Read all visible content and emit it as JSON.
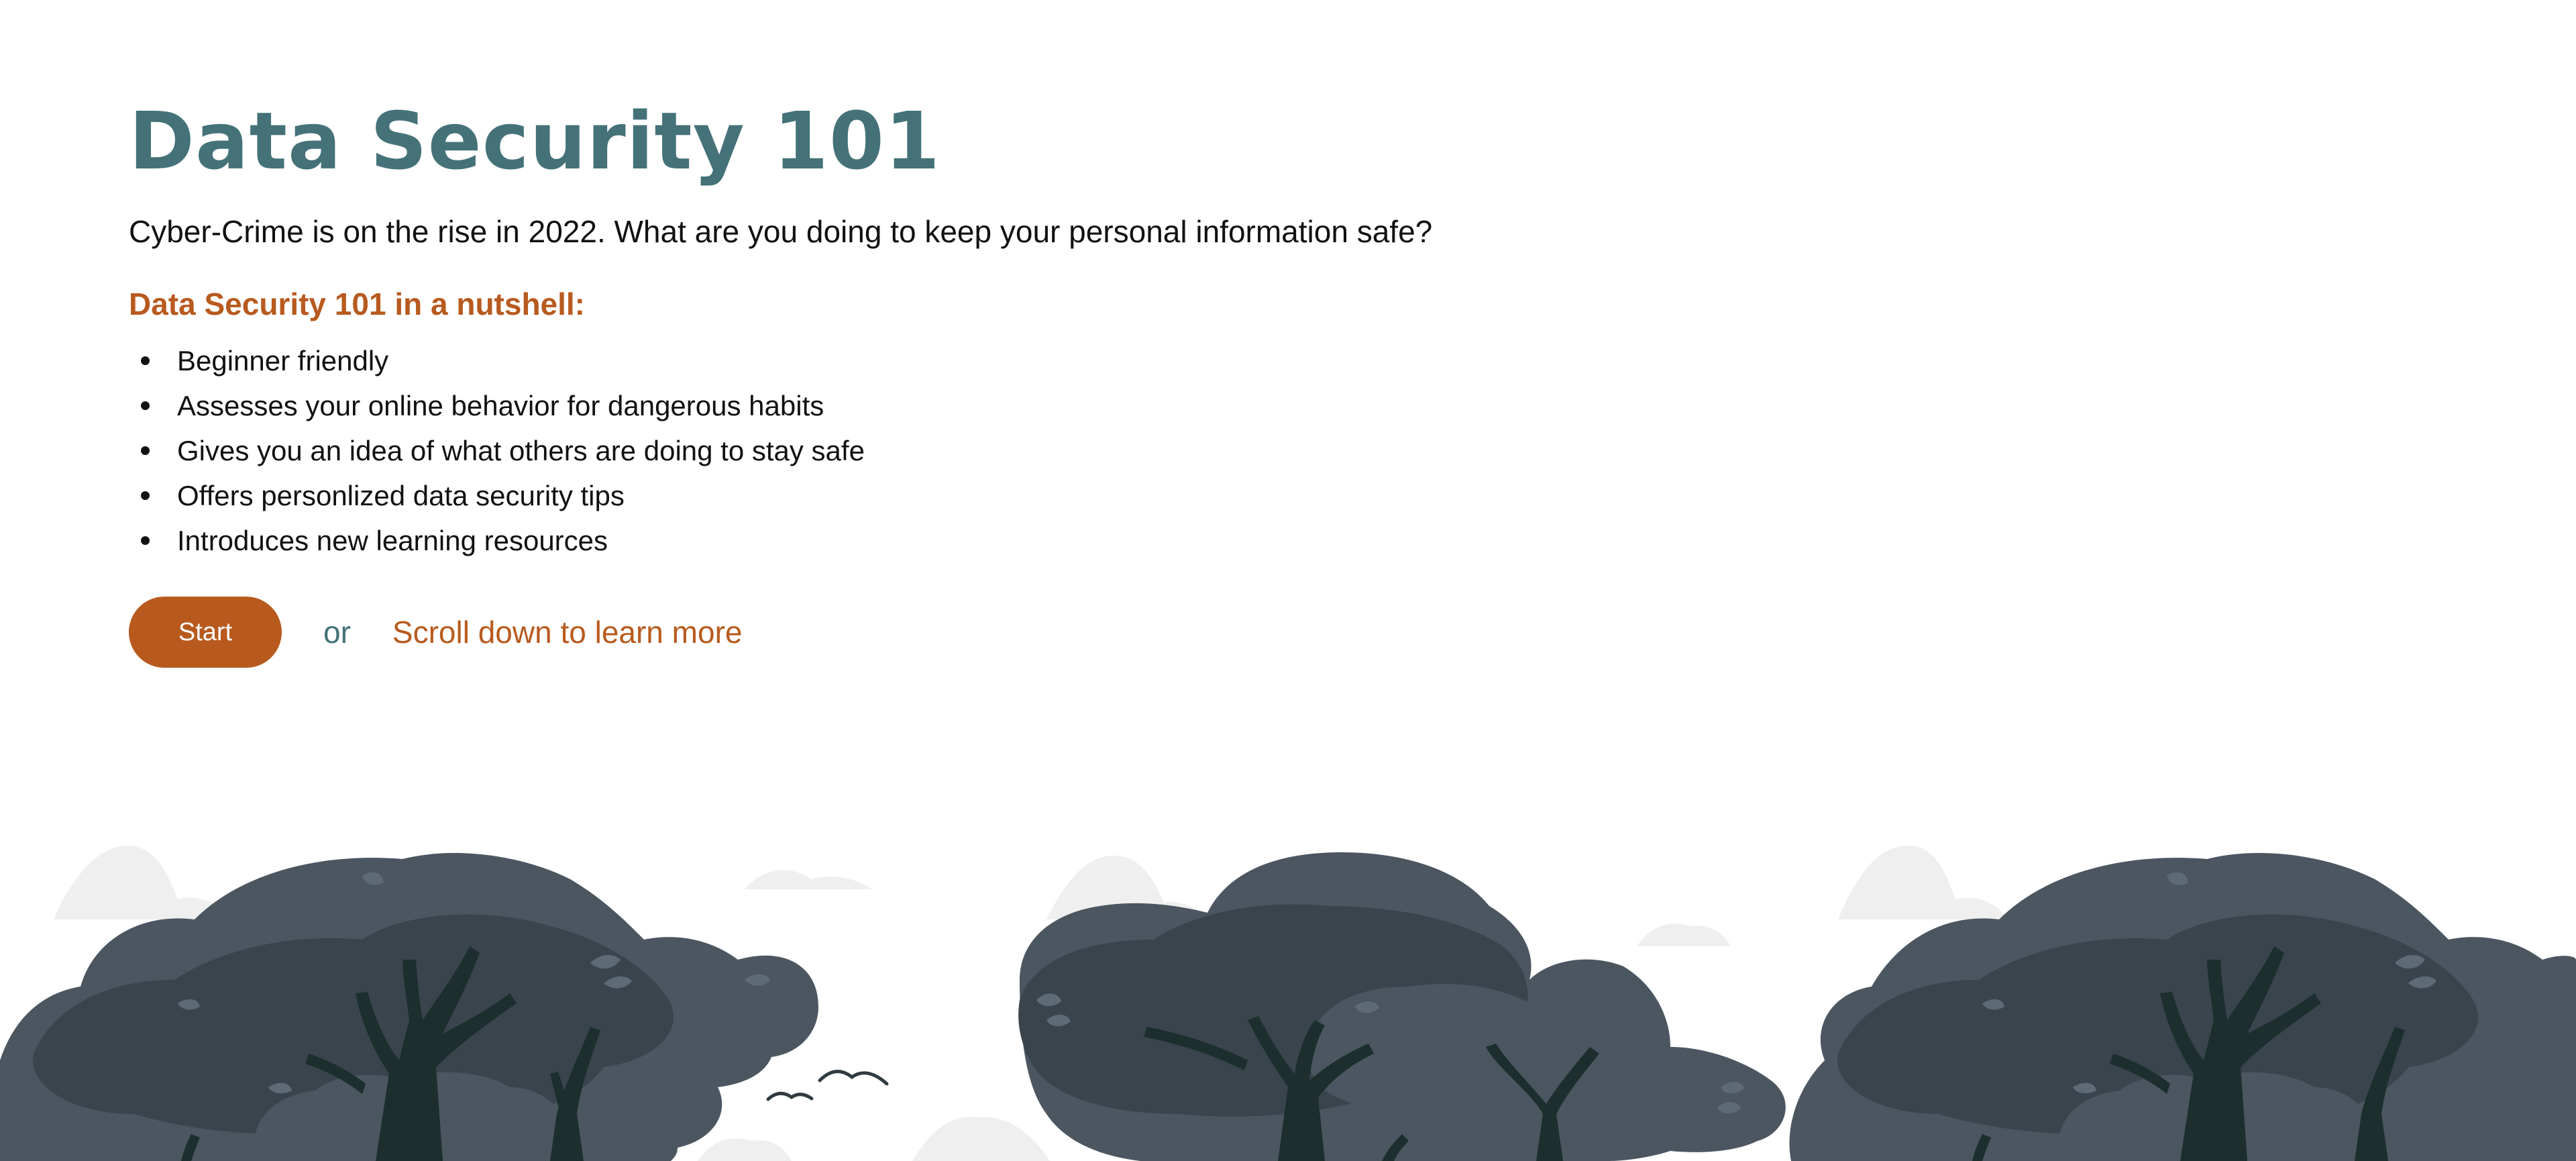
{
  "hero": {
    "title": "Data Security 101",
    "subtitle": "Cyber-Crime is on the rise in 2022. What are you doing to keep your personal information safe?",
    "nutshell_heading": "Data Security 101 in a nutshell:",
    "features": [
      "Beginner friendly",
      "Assesses your online behavior for dangerous habits",
      "Gives you an idea of what others are doing to stay safe",
      "Offers personlized data security tips",
      "Introduces new learning resources"
    ],
    "start_label": "Start",
    "or_label": "or",
    "learn_more_label": "Scroll down to learn more"
  },
  "colors": {
    "title": "#447278",
    "accent": "#b85a1e",
    "text": "#111111",
    "tree_light": "#4b5660",
    "tree_dark": "#3a444d",
    "trunk": "#1c2e2e",
    "cloud": "#ededed"
  },
  "illustration": {
    "icon": "forest-trees-illustration"
  }
}
